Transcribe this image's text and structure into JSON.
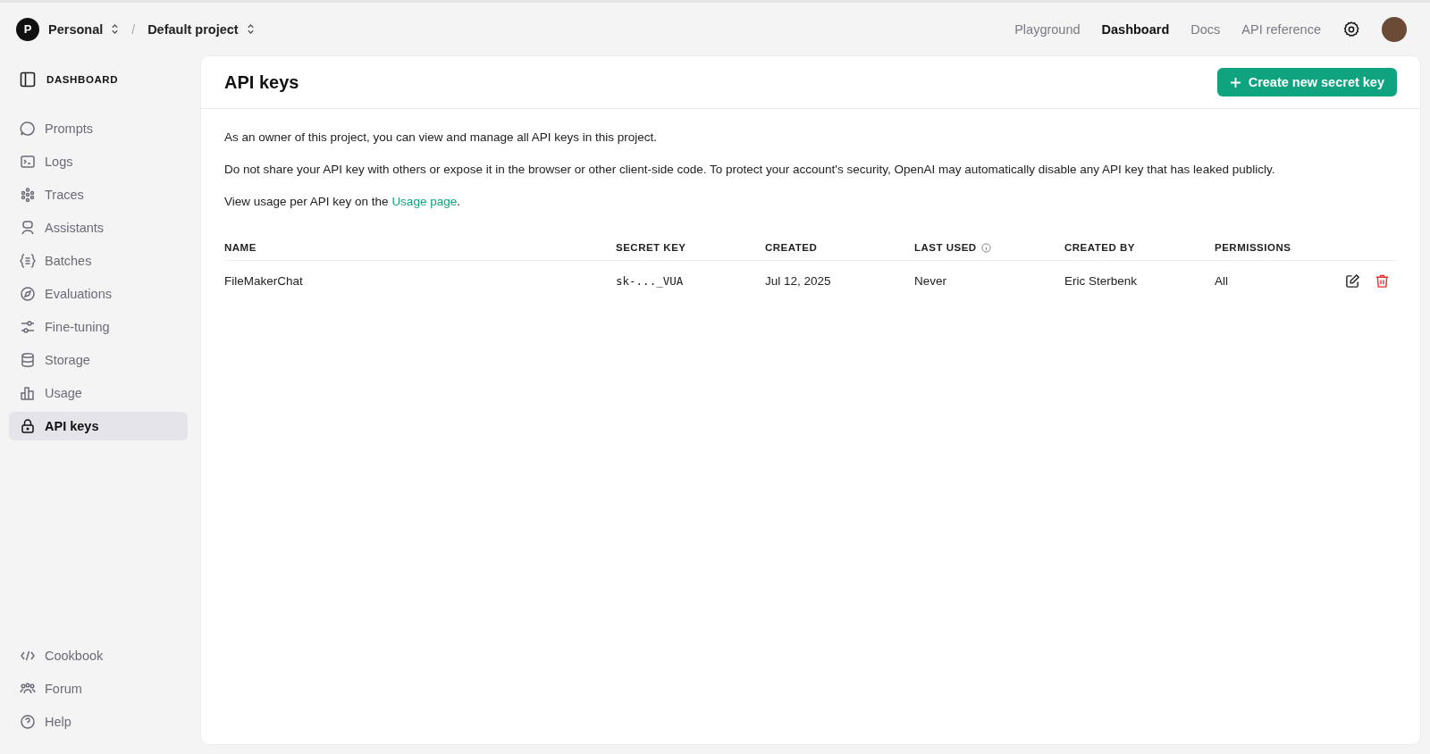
{
  "topbar": {
    "org": {
      "initial": "P",
      "name": "Personal"
    },
    "separator": "/",
    "project": "Default project",
    "nav": [
      {
        "label": "Playground",
        "selected": false
      },
      {
        "label": "Dashboard",
        "selected": true
      },
      {
        "label": "Docs",
        "selected": false
      },
      {
        "label": "API reference",
        "selected": false
      }
    ]
  },
  "sidebar": {
    "heading": "DASHBOARD",
    "items": [
      {
        "label": "Prompts",
        "selected": false
      },
      {
        "label": "Logs",
        "selected": false
      },
      {
        "label": "Traces",
        "selected": false
      },
      {
        "label": "Assistants",
        "selected": false
      },
      {
        "label": "Batches",
        "selected": false
      },
      {
        "label": "Evaluations",
        "selected": false
      },
      {
        "label": "Fine-tuning",
        "selected": false
      },
      {
        "label": "Storage",
        "selected": false
      },
      {
        "label": "Usage",
        "selected": false
      },
      {
        "label": "API keys",
        "selected": true
      }
    ],
    "footer_items": [
      {
        "label": "Cookbook"
      },
      {
        "label": "Forum"
      },
      {
        "label": "Help"
      }
    ]
  },
  "page": {
    "title": "API keys",
    "create_button": "Create new secret key",
    "paragraphs": [
      "As an owner of this project, you can view and manage all API keys in this project.",
      "Do not share your API key with others or expose it in the browser or other client-side code. To protect your account's security, OpenAI may automatically disable any API key that has leaked publicly."
    ],
    "usage_note": {
      "text": "View usage per API key on the",
      "link": "Usage page",
      "end": "."
    }
  },
  "table": {
    "columns": [
      {
        "label": "NAME",
        "info": false
      },
      {
        "label": "SECRET KEY",
        "info": false
      },
      {
        "label": "CREATED",
        "info": false
      },
      {
        "label": "LAST USED",
        "info": true
      },
      {
        "label": "CREATED BY",
        "info": false
      },
      {
        "label": "PERMISSIONS",
        "info": false
      }
    ],
    "rows": [
      {
        "cells": [
          "FileMakerChat",
          "sk-..._VUA",
          "Jul 12, 2025",
          "Never",
          "Eric Sterbenk",
          "All"
        ]
      }
    ]
  }
}
